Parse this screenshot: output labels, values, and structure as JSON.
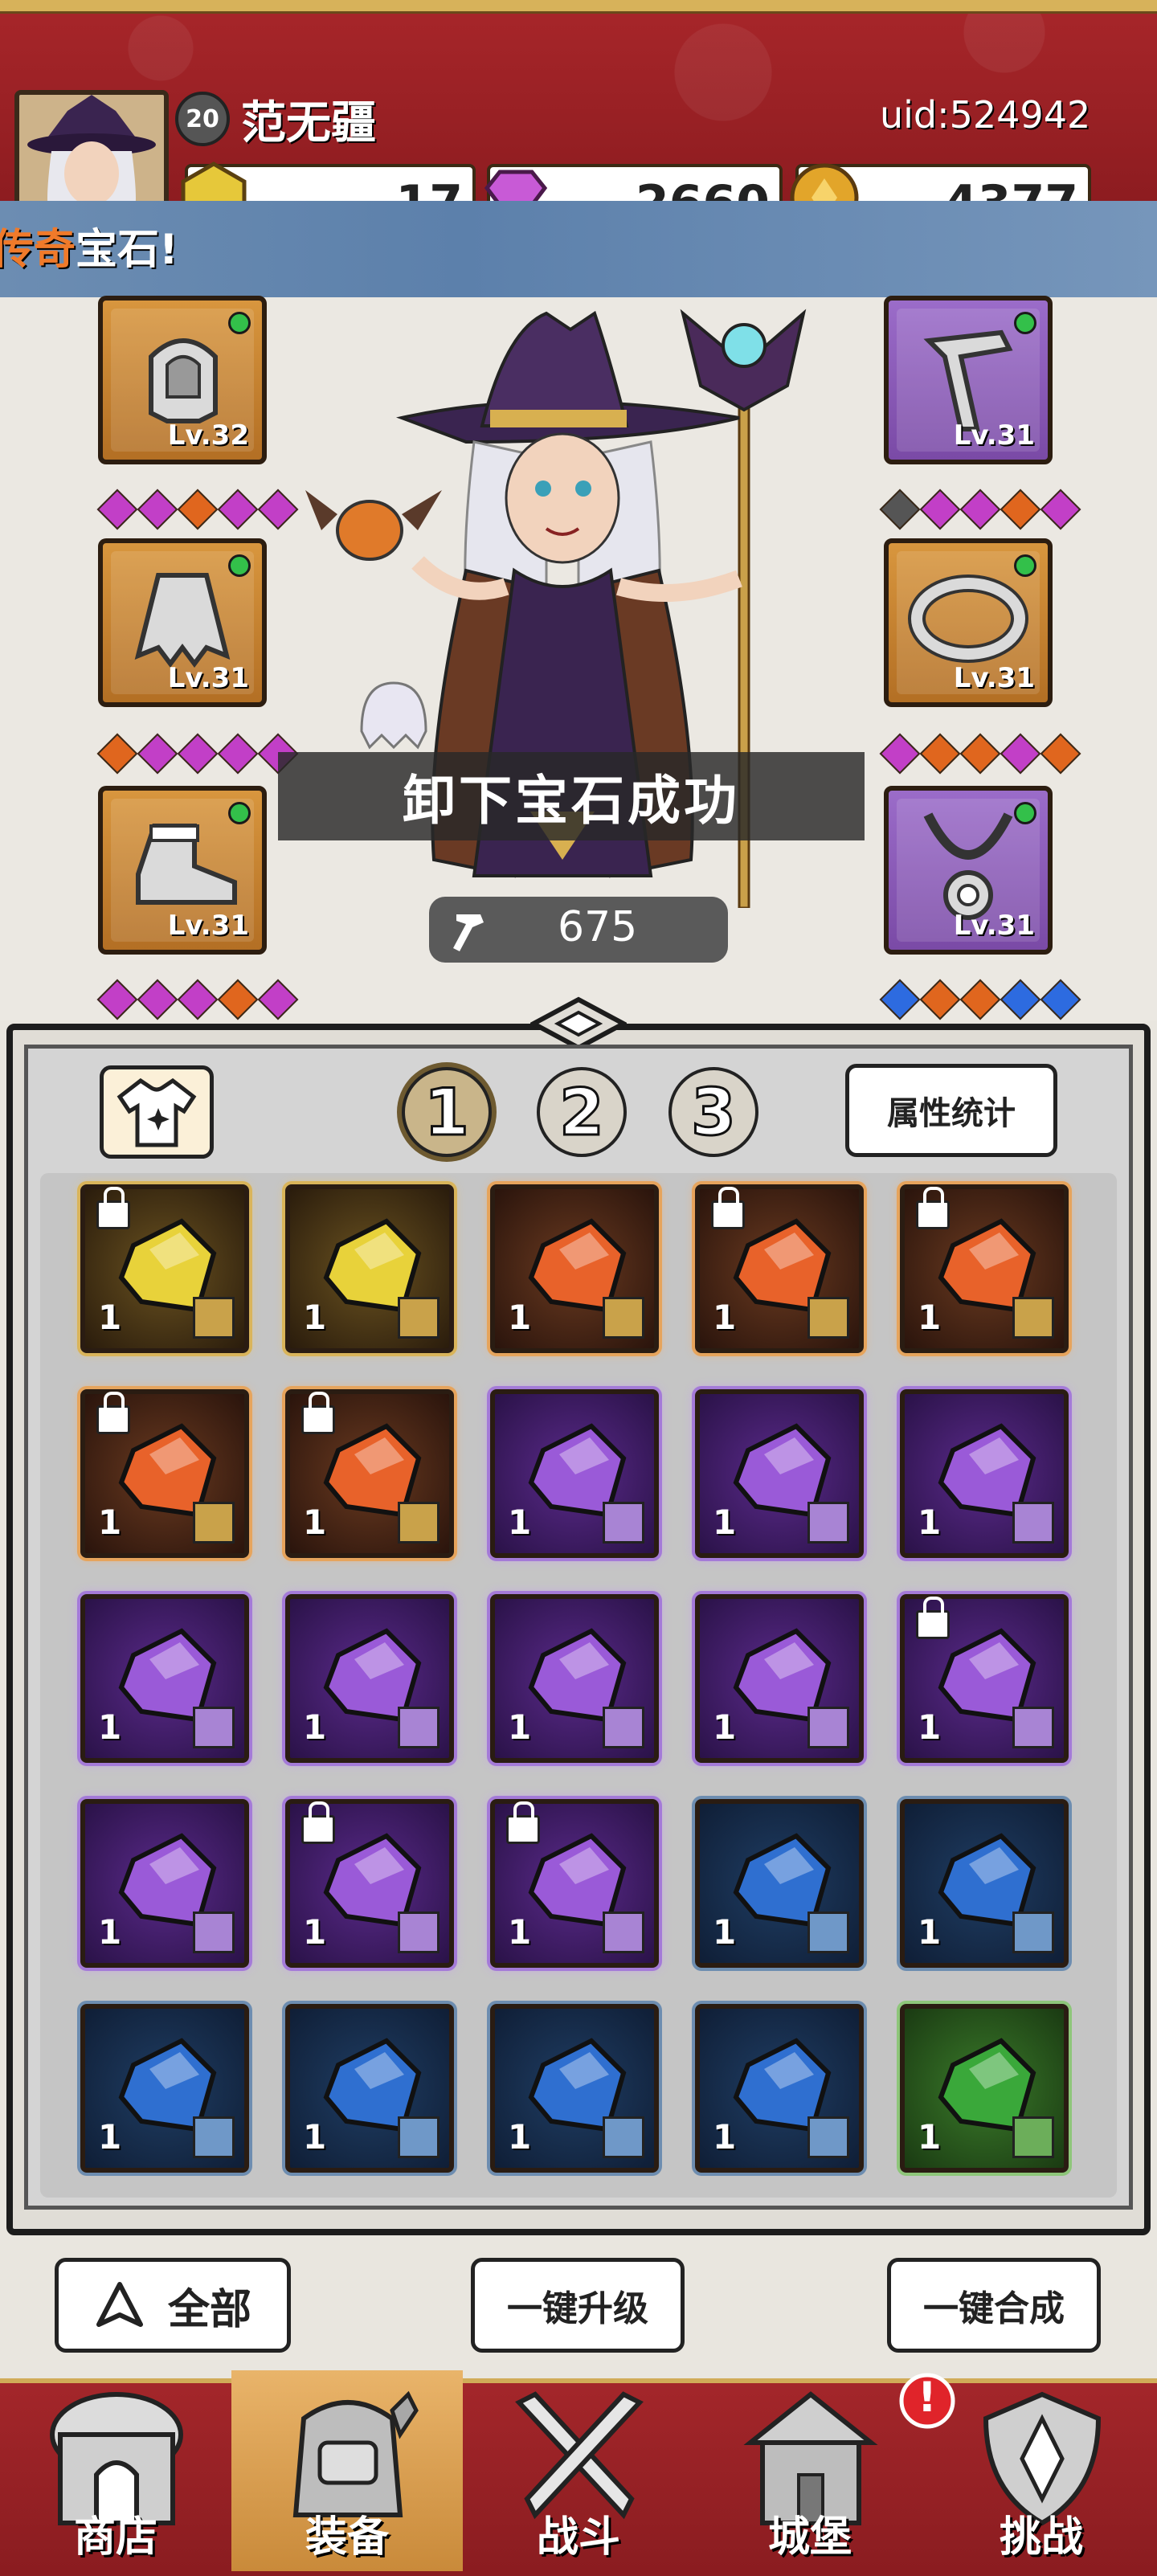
{
  "player": {
    "level": "20",
    "name": "范无疆",
    "uid": "uid:524942"
  },
  "currencies": [
    {
      "icon": "gold-crystal-icon",
      "value": "17",
      "color": "#e6c83a"
    },
    {
      "icon": "diamond-icon",
      "value": "2660",
      "color": "#c85ad6"
    },
    {
      "icon": "coin-icon",
      "value": "4377",
      "color": "#e2a52a"
    }
  ],
  "ticker": {
    "part1": "传奇",
    "part2": "宝石!"
  },
  "equipment": {
    "left": [
      {
        "name": "helmet",
        "level": "Lv.32",
        "rarity": "orange",
        "gems": [
          "m",
          "m",
          "o",
          "m",
          "m"
        ]
      },
      {
        "name": "cape",
        "level": "Lv.31",
        "rarity": "orange",
        "gems": [
          "o",
          "m",
          "m",
          "m",
          "m"
        ]
      },
      {
        "name": "boots",
        "level": "Lv.31",
        "rarity": "orange",
        "gems": [
          "m",
          "m",
          "m",
          "o",
          "m"
        ]
      }
    ],
    "right": [
      {
        "name": "weapon",
        "level": "Lv.31",
        "rarity": "purple",
        "gems": [
          "k",
          "m",
          "m",
          "o",
          "m"
        ]
      },
      {
        "name": "ring",
        "level": "Lv.31",
        "rarity": "orange",
        "gems": [
          "m",
          "o",
          "o",
          "m",
          "o"
        ]
      },
      {
        "name": "necklace",
        "level": "Lv.31",
        "rarity": "purple",
        "gems": [
          "b",
          "o",
          "o",
          "b",
          "b"
        ]
      }
    ]
  },
  "toast": "卸下宝石成功",
  "power": {
    "value": "675"
  },
  "tabs": {
    "t1": "1",
    "t2": "2",
    "t3": "3",
    "stats_label": "属性统计"
  },
  "inventory": [
    {
      "color": "yellow",
      "count": "1",
      "locked": true
    },
    {
      "color": "yellow",
      "count": "1",
      "locked": false
    },
    {
      "color": "orange",
      "count": "1",
      "locked": false
    },
    {
      "color": "orange",
      "count": "1",
      "locked": true
    },
    {
      "color": "orange",
      "count": "1",
      "locked": true
    },
    {
      "color": "orange",
      "count": "1",
      "locked": true
    },
    {
      "color": "orange",
      "count": "1",
      "locked": true
    },
    {
      "color": "purple",
      "count": "1",
      "locked": false
    },
    {
      "color": "purple",
      "count": "1",
      "locked": false
    },
    {
      "color": "purple",
      "count": "1",
      "locked": false
    },
    {
      "color": "purple",
      "count": "1",
      "locked": false
    },
    {
      "color": "purple",
      "count": "1",
      "locked": false
    },
    {
      "color": "purple",
      "count": "1",
      "locked": false
    },
    {
      "color": "purple",
      "count": "1",
      "locked": false
    },
    {
      "color": "purple",
      "count": "1",
      "locked": true
    },
    {
      "color": "purple",
      "count": "1",
      "locked": false
    },
    {
      "color": "purple",
      "count": "1",
      "locked": true
    },
    {
      "color": "purple",
      "count": "1",
      "locked": true
    },
    {
      "color": "blue",
      "count": "1",
      "locked": false
    },
    {
      "color": "blue",
      "count": "1",
      "locked": false
    },
    {
      "color": "blue",
      "count": "1",
      "locked": false
    },
    {
      "color": "blue",
      "count": "1",
      "locked": false
    },
    {
      "color": "blue",
      "count": "1",
      "locked": false
    },
    {
      "color": "blue",
      "count": "1",
      "locked": false
    },
    {
      "color": "green",
      "count": "1",
      "locked": false
    }
  ],
  "actions": {
    "filter_all": "全部",
    "upgrade_all": "一键升级",
    "merge_all": "一键合成"
  },
  "nav": [
    {
      "label": "商店",
      "active": false
    },
    {
      "label": "装备",
      "active": true
    },
    {
      "label": "战斗",
      "active": false
    },
    {
      "label": "城堡",
      "active": false,
      "badge": "!"
    },
    {
      "label": "挑战",
      "active": false
    }
  ]
}
